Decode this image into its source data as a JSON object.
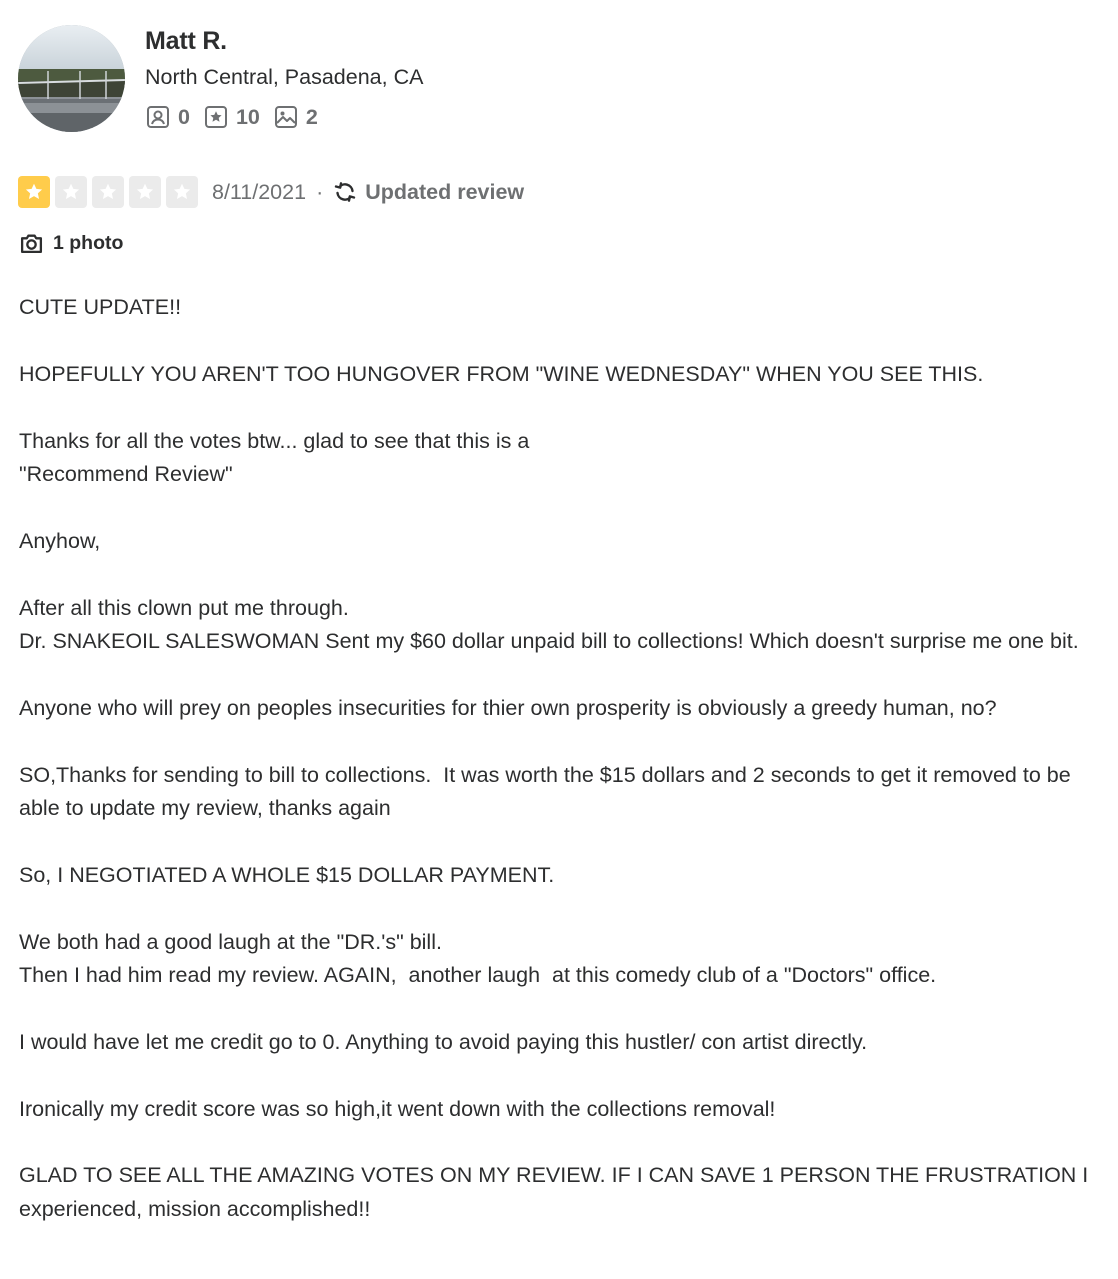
{
  "reviewer": {
    "name": "Matt R.",
    "location": "North Central, Pasadena, CA",
    "stats": {
      "friends": "0",
      "reviews": "10",
      "photos": "2"
    }
  },
  "review": {
    "rating": 1,
    "rating_max": 5,
    "star_color_filled": "#ffcc4b",
    "star_color_empty": "#ebebeb",
    "date": "8/11/2021",
    "separator": "·",
    "updated_label": "Updated review",
    "photo_label": "1 photo",
    "paragraphs": [
      "CUTE UPDATE!!",
      "HOPEFULLY YOU AREN'T TOO HUNGOVER FROM \"WINE WEDNESDAY\" WHEN YOU SEE THIS.",
      "Thanks for all the votes btw... glad to see that this is a\n\"Recommend Review\"",
      "Anyhow,",
      "After all this clown put me through.\nDr. SNAKEOIL SALESWOMAN Sent my $60 dollar unpaid bill to collections! Which doesn't surprise me one bit.",
      "Anyone who will prey on peoples insecurities for thier own prosperity is obviously a greedy human, no?",
      "SO,Thanks for sending to bill to collections.  It was worth the $15 dollars and 2 seconds to get it removed to be able to update my review, thanks again",
      "So, I NEGOTIATED A WHOLE $15 DOLLAR PAYMENT.",
      "We both had a good laugh at the \"DR.'s\" bill.\nThen I had him read my review. AGAIN,  another laugh  at this comedy club of a \"Doctors\" office.",
      "I would have let me credit go to 0. Anything to avoid paying this hustler/ con artist directly.",
      "Ironically my credit score was so high,it went down with the collections removal!",
      "GLAD TO SEE ALL THE AMAZING VOTES ON MY REVIEW. IF I CAN SAVE 1 PERSON THE FRUSTRATION I experienced, mission accomplished!!"
    ]
  }
}
